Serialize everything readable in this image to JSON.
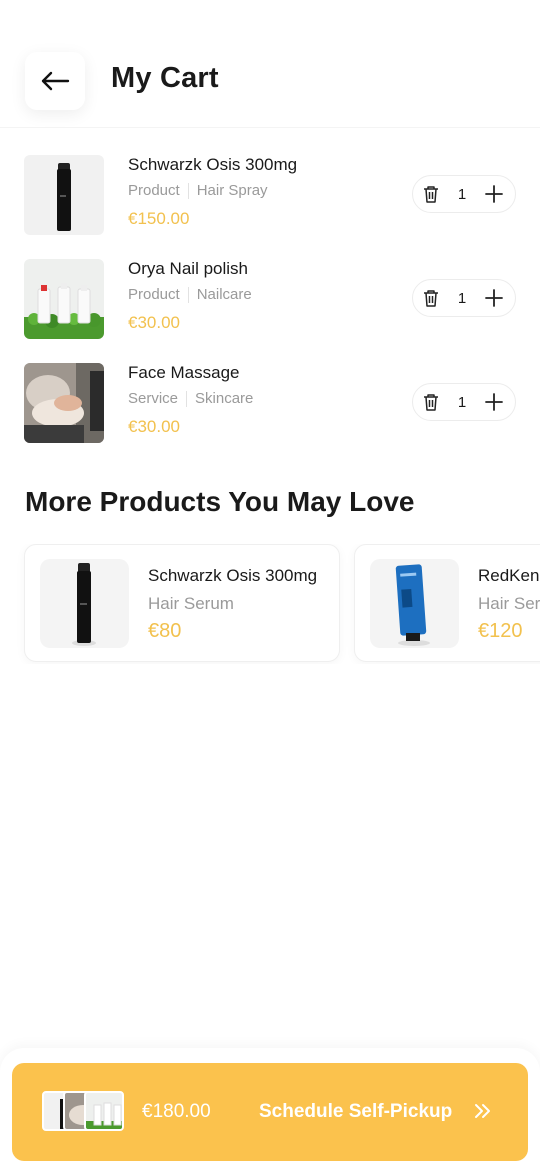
{
  "header": {
    "title": "My Cart"
  },
  "cart": {
    "items": [
      {
        "name": "Schwarzk Osis 300mg",
        "type": "Product",
        "category": "Hair Spray",
        "price": "€150.00",
        "qty": "1"
      },
      {
        "name": "Orya Nail polish",
        "type": "Product",
        "category": "Nailcare",
        "price": "€30.00",
        "qty": "1"
      },
      {
        "name": "Face Massage",
        "type": "Service",
        "category": "Skincare",
        "price": "€30.00",
        "qty": "1"
      }
    ]
  },
  "recommendations": {
    "title": "More Products You May Love",
    "items": [
      {
        "name": "Schwarzk Osis 300mg",
        "category": "Hair Serum",
        "price": "€80"
      },
      {
        "name": "RedKen",
        "category": "Hair Serum",
        "price": "€120"
      }
    ]
  },
  "checkout": {
    "total": "€180.00",
    "cta_label": "Schedule Self-Pickup"
  },
  "colors": {
    "accent": "#fbc24d",
    "price": "#f2c14e",
    "muted": "#9a9a9a"
  },
  "icons": [
    "arrow-left-icon",
    "trash-icon",
    "plus-icon",
    "double-chevron-right-icon"
  ]
}
